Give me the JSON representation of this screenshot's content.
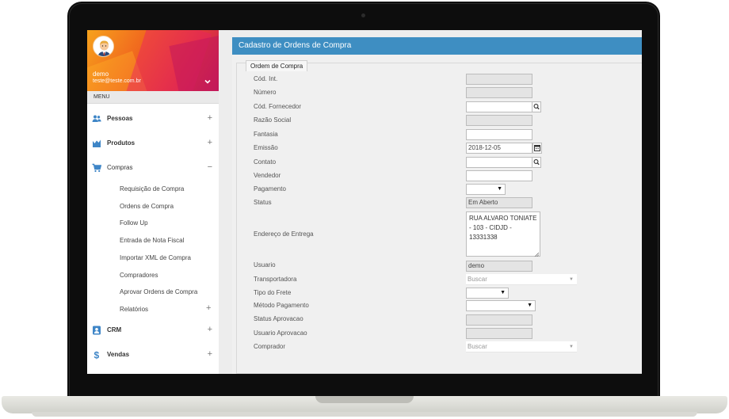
{
  "sidebar": {
    "user_name": "demo",
    "user_email": "teste@teste.com.br",
    "menu_label": "MENU",
    "items": [
      {
        "label": "Pessoas",
        "icon": "users-icon",
        "toggle": "+"
      },
      {
        "label": "Produtos",
        "icon": "chart-icon",
        "toggle": "+"
      },
      {
        "label": "Compras",
        "icon": "cart-icon",
        "toggle": "−"
      },
      {
        "label": "CRM",
        "icon": "contact-icon",
        "toggle": "+"
      },
      {
        "label": "Vendas",
        "icon": "dollar-icon",
        "toggle": "+"
      }
    ],
    "compras_sub": [
      "Requisição de Compra",
      "Ordens de Compra",
      "Follow Up",
      "Entrada de Nota Fiscal",
      "Importar XML de Compra",
      "Compradores",
      "Aprovar Ordens de Compra",
      "Relatórios"
    ],
    "relatorios_toggle": "+"
  },
  "main": {
    "title": "Cadastro de Ordens de Compra",
    "tab": "Ordem de Compra",
    "fields": {
      "cod_int": {
        "label": "Cód. Int.",
        "value": ""
      },
      "numero": {
        "label": "Número",
        "value": ""
      },
      "cod_fornecedor": {
        "label": "Cód. Fornecedor",
        "value": ""
      },
      "razao_social": {
        "label": "Razão Social",
        "value": ""
      },
      "fantasia": {
        "label": "Fantasia",
        "value": ""
      },
      "emissao": {
        "label": "Emissão",
        "value": "2018-12-05"
      },
      "contato": {
        "label": "Contato",
        "value": ""
      },
      "vendedor": {
        "label": "Vendedor",
        "value": ""
      },
      "pagamento": {
        "label": "Pagamento",
        "value": ""
      },
      "status": {
        "label": "Status",
        "value": "Em Aberto"
      },
      "endereco": {
        "label": "Endereço de Entrega",
        "value": "RUA ALVARO TONIATE - 103 - CIDJD - 13331338"
      },
      "usuario": {
        "label": "Usuario",
        "value": "demo"
      },
      "transportadora": {
        "label": "Transportadora",
        "placeholder": "Buscar"
      },
      "tipo_frete": {
        "label": "Tipo do Frete",
        "value": ""
      },
      "metodo_pagamento": {
        "label": "Método Pagamento",
        "value": ""
      },
      "status_aprovacao": {
        "label": "Status Aprovacao",
        "value": ""
      },
      "usuario_aprovacao": {
        "label": "Usuario Aprovacao",
        "value": ""
      },
      "comprador": {
        "label": "Comprador",
        "placeholder": "Buscar"
      }
    }
  },
  "colors": {
    "header_blue": "#3e8ec2",
    "profile_orange": "#f0641f",
    "profile_magenta": "#c2185b",
    "icon_blue": "#3f86c7"
  }
}
